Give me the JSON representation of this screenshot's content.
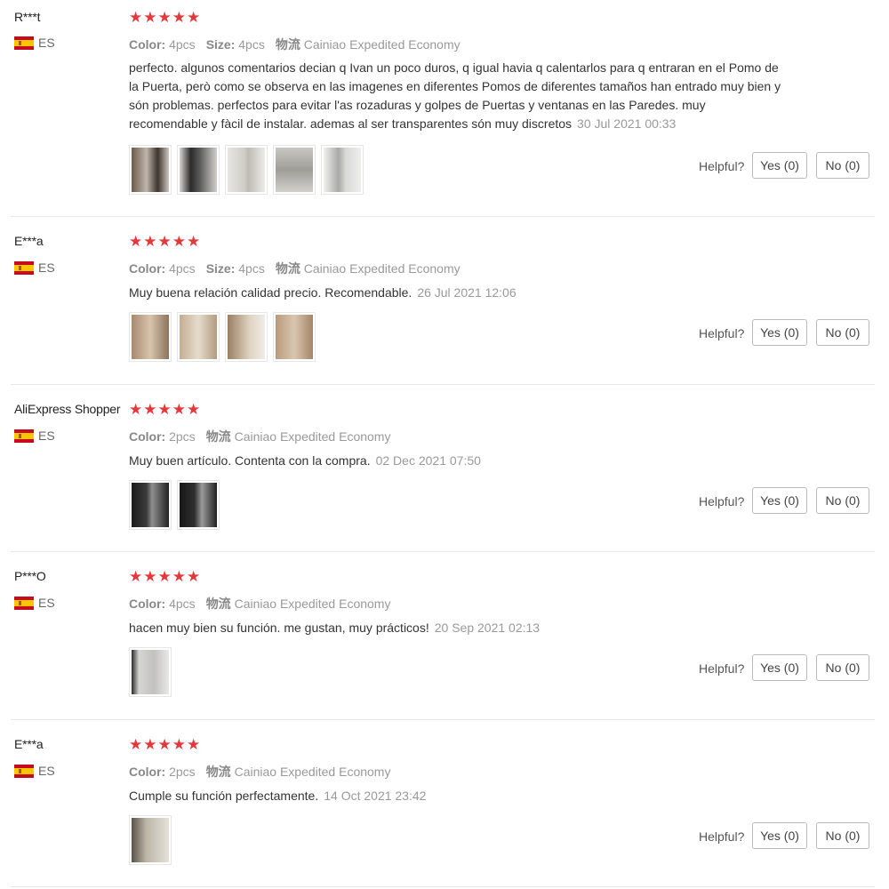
{
  "helpful_label": "Helpful?",
  "reviews": [
    {
      "user": "R***t",
      "country": "ES",
      "stars": 5,
      "color_label": "Color:",
      "color_value": "4pcs",
      "size_label": "Size:",
      "size_value": "4pcs",
      "shipping_label": "物流",
      "shipping_value": "Cainiao Expedited Economy",
      "text": "perfecto. algunos comentarios decian q Ivan un poco duros, q igual havia q calentarlos para q entraran en el Pomo de la Puerta, però como se observa en las imagenes en diferentes Pomos de diferentes tamaños han entrado muy bien y són problemas. perfectos para evitar l'as rozaduras y golpes de Puertas y ventanas en las Paredes. muy recomendable y fàcil de instalar. ademas al ser transparentes són muy discretos",
      "date": "30 Jul 2021 00:33",
      "photos": 5,
      "yes_label": "Yes (0)",
      "no_label": "No (0)"
    },
    {
      "user": "E***a",
      "country": "ES",
      "stars": 5,
      "color_label": "Color:",
      "color_value": "4pcs",
      "size_label": "Size:",
      "size_value": "4pcs",
      "shipping_label": "物流",
      "shipping_value": "Cainiao Expedited Economy",
      "text": "Muy buena relación calidad precio. Recomendable.",
      "date": "26 Jul 2021 12:06",
      "photos": 4,
      "yes_label": "Yes (0)",
      "no_label": "No (0)"
    },
    {
      "user": "AliExpress Shopper",
      "country": "ES",
      "stars": 5,
      "color_label": "Color:",
      "color_value": "2pcs",
      "shipping_label": "物流",
      "shipping_value": "Cainiao Expedited Economy",
      "text": "Muy buen artículo. Contenta con la compra.",
      "date": "02 Dec 2021 07:50",
      "photos": 2,
      "yes_label": "Yes (0)",
      "no_label": "No (0)"
    },
    {
      "user": "P***O",
      "country": "ES",
      "stars": 5,
      "color_label": "Color:",
      "color_value": "4pcs",
      "shipping_label": "物流",
      "shipping_value": "Cainiao Expedited Economy",
      "text": "hacen muy bien su función. me gustan, muy prácticos!",
      "date": "20 Sep 2021 02:13",
      "photos": 1,
      "yes_label": "Yes (0)",
      "no_label": "No (0)"
    },
    {
      "user": "E***a",
      "country": "ES",
      "stars": 5,
      "color_label": "Color:",
      "color_value": "2pcs",
      "shipping_label": "物流",
      "shipping_value": "Cainiao Expedited Economy",
      "text": "Cumple su función perfectamente.",
      "date": "14 Oct 2021 23:42",
      "photos": 1,
      "yes_label": "Yes (0)",
      "no_label": "No (0)"
    }
  ],
  "colors": {
    "star": "#e4393c",
    "muted": "#999999"
  }
}
